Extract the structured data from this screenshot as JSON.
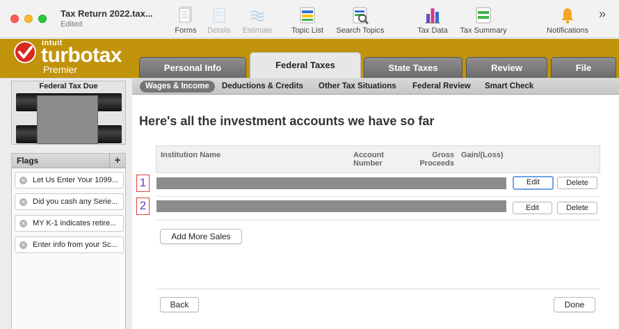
{
  "window": {
    "title": "Tax Return 2022.tax...",
    "status": "Edited"
  },
  "toolbar": {
    "items": [
      {
        "label": "Forms",
        "icon": "forms-icon",
        "enabled": true
      },
      {
        "label": "Details",
        "icon": "details-icon",
        "enabled": false
      },
      {
        "label": "Estimate",
        "icon": "estimate-icon",
        "enabled": false
      },
      {
        "label": "Topic List",
        "icon": "topic-list-icon",
        "enabled": true
      },
      {
        "label": "Search Topics",
        "icon": "search-topics-icon",
        "enabled": true
      },
      {
        "label": "Tax Data",
        "icon": "tax-data-chart-icon",
        "enabled": true
      },
      {
        "label": "Tax Summary",
        "icon": "tax-summary-icon",
        "enabled": true
      },
      {
        "label": "Notifications",
        "icon": "bell-icon",
        "enabled": true
      }
    ],
    "overflow": "»"
  },
  "brand": {
    "company": "intuit",
    "product": "turbotax",
    "edition": "Premier",
    "color": "#c0930a"
  },
  "main_tabs": [
    {
      "label": "Personal Info",
      "active": false
    },
    {
      "label": "Federal Taxes",
      "active": true
    },
    {
      "label": "State Taxes",
      "active": false
    },
    {
      "label": "Review",
      "active": false
    },
    {
      "label": "File",
      "active": false
    }
  ],
  "sub_tabs": [
    {
      "label": "Wages & Income",
      "active": true
    },
    {
      "label": "Deductions & Credits",
      "active": false
    },
    {
      "label": "Other Tax Situations",
      "active": false
    },
    {
      "label": "Federal Review",
      "active": false
    },
    {
      "label": "Smart Check",
      "active": false
    }
  ],
  "sidebar": {
    "tax_due_title": "Federal Tax Due",
    "flags_title": "Flags",
    "flags_add": "+",
    "flags": [
      "Let Us Enter Your 1099...",
      "Did you cash any Serie...",
      "MY K-1 indicates retire...",
      "Enter info from your Sc..."
    ]
  },
  "main": {
    "heading": "Here's all the investment accounts we have so far",
    "table": {
      "columns": {
        "institution": "Institution Name",
        "account_line1": "Account",
        "account_line2": "Number",
        "gross_line1": "Gross",
        "gross_line2": "Proceeds",
        "gain": "Gain/(Loss)"
      },
      "rows": [
        {
          "marker": "1",
          "edit": "Edit",
          "delete": "Delete"
        },
        {
          "marker": "2",
          "edit": "Edit",
          "delete": "Delete"
        }
      ]
    },
    "add_more": "Add More Sales",
    "back": "Back",
    "done": "Done"
  }
}
